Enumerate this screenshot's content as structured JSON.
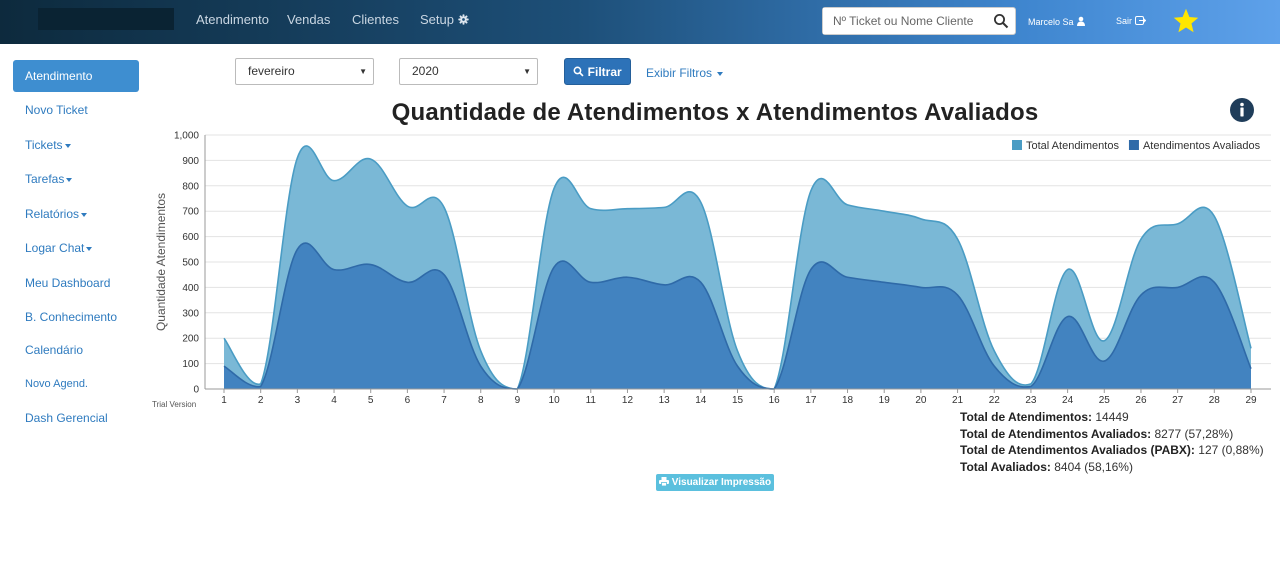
{
  "topbar": {
    "nav": [
      {
        "label": "Atendimento"
      },
      {
        "label": "Vendas"
      },
      {
        "label": "Clientes"
      },
      {
        "label": "Setup"
      }
    ],
    "search_placeholder": "Nº Ticket ou Nome Cliente",
    "user_name": "Marcelo Sa",
    "logout_label": "Sair",
    "accent_star": "#ffe600"
  },
  "sidebar": {
    "items": [
      {
        "label": "Atendimento",
        "active": true
      },
      {
        "label": "Novo Ticket"
      },
      {
        "label": "Tickets"
      },
      {
        "label": "Tarefas"
      },
      {
        "label": "Relatórios"
      },
      {
        "label": "Logar Chat"
      },
      {
        "label": "Meu Dashboard"
      },
      {
        "label": "B. Conhecimento"
      },
      {
        "label": "Calendário"
      },
      {
        "label": "Novo Agend."
      },
      {
        "label": "Dash Gerencial"
      }
    ]
  },
  "filters": {
    "month": "fevereiro",
    "year": "2020",
    "filter_button": "Filtrar",
    "show_filters": "Exibir Filtros"
  },
  "chart_data": {
    "type": "area",
    "title": "Quantidade de Atendimentos x Atendimentos Avaliados",
    "ylabel": "Quantidade Atendimentos",
    "xlabel": "",
    "watermark": "Trial Version",
    "ylim": [
      0,
      1000
    ],
    "yticks": [
      "0",
      "100",
      "200",
      "300",
      "400",
      "500",
      "600",
      "700",
      "800",
      "900",
      "1,000"
    ],
    "legend_position": "top-right",
    "x": [
      1,
      2,
      3,
      4,
      5,
      6,
      7,
      8,
      9,
      10,
      11,
      12,
      13,
      14,
      15,
      16,
      17,
      18,
      19,
      20,
      21,
      22,
      23,
      24,
      25,
      26,
      27,
      28,
      29
    ],
    "series": [
      {
        "name": "Total Atendimentos",
        "color": "#7ab8d6",
        "values": [
          200,
          20,
          910,
          820,
          905,
          720,
          715,
          150,
          0,
          790,
          710,
          710,
          715,
          735,
          150,
          0,
          780,
          725,
          700,
          670,
          590,
          150,
          20,
          470,
          190,
          590,
          650,
          680,
          160
        ]
      },
      {
        "name": "Atendimentos Avaliados",
        "color": "#3f7fbf",
        "values": [
          90,
          10,
          550,
          470,
          490,
          420,
          450,
          90,
          0,
          480,
          420,
          440,
          410,
          420,
          90,
          0,
          470,
          440,
          420,
          400,
          370,
          90,
          10,
          285,
          110,
          370,
          400,
          420,
          80
        ]
      }
    ]
  },
  "totals": [
    {
      "label": "Total de Atendimentos:",
      "value": "14449"
    },
    {
      "label": "Total de Atendimentos Avaliados:",
      "value": "8277 (57,28%)"
    },
    {
      "label": "Total de Atendimentos Avaliados (PABX):",
      "value": "127 (0,88%)"
    },
    {
      "label": "Total Avaliados:",
      "value": "8404 (58,16%)"
    }
  ],
  "print_button": "Visualizar Impressão"
}
